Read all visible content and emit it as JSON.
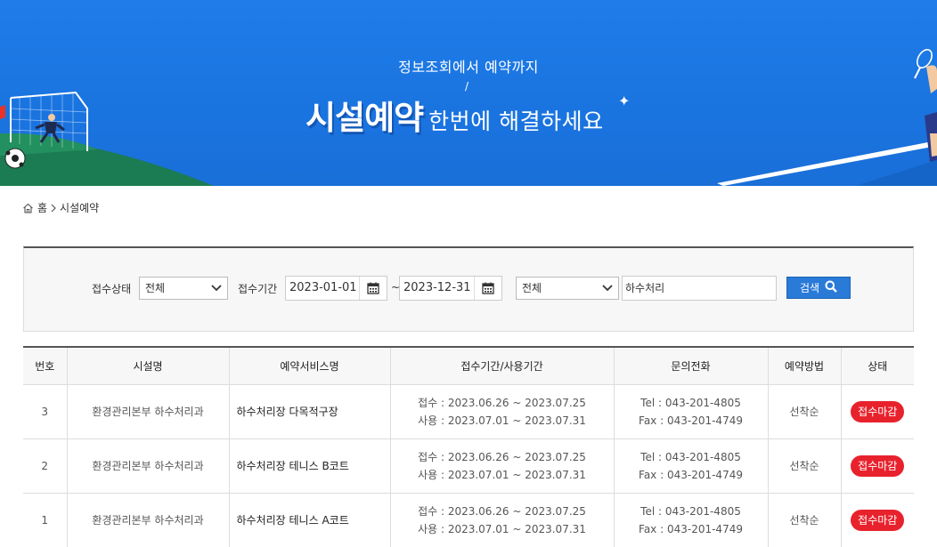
{
  "banner": {
    "subtitle": "정보조회에서 예약까지",
    "slash": "/",
    "title_bold": "시설예약",
    "title_light": "한번에 해결하세요",
    "colors": {
      "background": "#1a74e0",
      "grass": "#1b7b52"
    }
  },
  "breadcrumb": {
    "home_icon": "home-icon",
    "home": "홈",
    "separator_icon": "chevron-right-icon",
    "current": "시설예약"
  },
  "search": {
    "status_label": "접수상태",
    "status_value": "전체",
    "period_label": "접수기간",
    "date_from": "2023-01-01",
    "date_to": "2023-12-31",
    "tilde": "~",
    "field_value": "전체",
    "keyword": "하수처리",
    "button": "검색",
    "button_color": "#2a7ad8"
  },
  "table": {
    "headers": [
      "번호",
      "시설명",
      "예약서비스명",
      "접수기간/사용기간",
      "문의전화",
      "예약방법",
      "상태"
    ],
    "rows": [
      {
        "no": "3",
        "facility": "환경관리본부 하수처리과",
        "service": "하수처리장 다목적구장",
        "receipt": "접수 : 2023.06.26 ~ 2023.07.25",
        "use": "사용 : 2023.07.01 ~ 2023.07.31",
        "tel": "Tel : 043-201-4805",
        "fax": "Fax : 043-201-4749",
        "method": "선착순",
        "status": "접수마감"
      },
      {
        "no": "2",
        "facility": "환경관리본부 하수처리과",
        "service": "하수처리장 테니스 B코트",
        "receipt": "접수 : 2023.06.26 ~ 2023.07.25",
        "use": "사용 : 2023.07.01 ~ 2023.07.31",
        "tel": "Tel : 043-201-4805",
        "fax": "Fax : 043-201-4749",
        "method": "선착순",
        "status": "접수마감"
      },
      {
        "no": "1",
        "facility": "환경관리본부 하수처리과",
        "service": "하수처리장 테니스 A코트",
        "receipt": "접수 : 2023.06.26 ~ 2023.07.25",
        "use": "사용 : 2023.07.01 ~ 2023.07.31",
        "tel": "Tel : 043-201-4805",
        "fax": "Fax : 043-201-4749",
        "method": "선착순",
        "status": "접수마감"
      }
    ],
    "status_color": "#e8222d"
  }
}
